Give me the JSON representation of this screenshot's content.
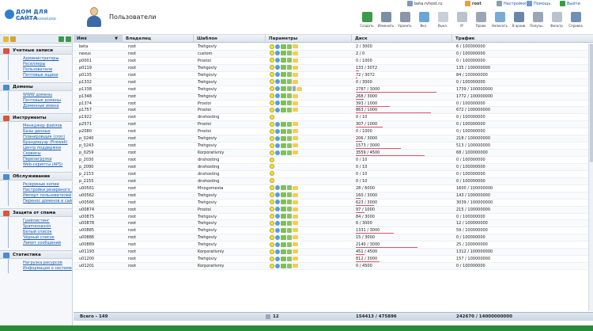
{
  "header": {
    "logo_title": "ДОМ ДЛЯ САЙТА",
    "logo_subtitle": "хостинг-провайдер",
    "page_title": "Пользователи",
    "host": "beta.rvhost.ru",
    "user": "root",
    "links": {
      "settings": "Настройки",
      "help": "Помощь",
      "exit": "Выйти"
    }
  },
  "toolbar": [
    {
      "icon": "create-icon",
      "label": "Создать",
      "color": "#3a9b48"
    },
    {
      "icon": "edit-icon",
      "label": "Изменить",
      "color": "#7a8ea5"
    },
    {
      "icon": "delete-icon",
      "label": "Удалить",
      "color": "#8a96a8"
    },
    {
      "icon": "enable-icon",
      "label": "Вкл.",
      "color": "#6aa4d8"
    },
    {
      "icon": "disable-icon",
      "label": "Выкл.",
      "color": "#c8cfd8"
    },
    {
      "icon": "ip-icon",
      "label": "IP",
      "color": "#b9c3cf"
    },
    {
      "icon": "rights-icon",
      "label": "Права",
      "color": "#9aa6b5"
    },
    {
      "icon": "message-icon",
      "label": "Написать",
      "color": "#7aaad6"
    },
    {
      "icon": "login-icon",
      "label": "В архив",
      "color": "#6a86a8"
    },
    {
      "icon": "columns-icon",
      "label": "Полузы...",
      "color": "#9aa6b5"
    },
    {
      "icon": "filter-icon",
      "label": "Фильтр",
      "color": "#b8c3cf"
    },
    {
      "icon": "help-icon",
      "label": "Справка",
      "color": "#6f8fb5"
    }
  ],
  "sidebar": [
    {
      "title": "Учетные записи",
      "icon_color": "#d9553b",
      "items": [
        "Администраторы",
        "Реселлеры",
        "Пользователи",
        "Почтовые ящики"
      ]
    },
    {
      "title": "Домены",
      "icon_color": "#4a8ad0",
      "items": [
        "WWW домены",
        "Почтовые домены",
        "Доменные имена"
      ]
    },
    {
      "title": "Инструменты",
      "icon_color": "#d9553b",
      "items": [
        "Менеджер файлов",
        "Базы данных",
        "Планировщик (cron)",
        "Брандмауэр (Firewall)",
        "Центр поддержки",
        "Сервисы",
        "Перезагрузка",
        "Web-скрипты (APS)"
      ]
    },
    {
      "title": "Обслуживание",
      "icon_color": "#4a8ad0",
      "items": [
        "Резервные копии",
        "Настройки резервного копирования",
        "Импорт пользователей",
        "Перенос доменов и сайт"
      ]
    },
    {
      "title": "Защита от спама",
      "icon_color": "#d9553b",
      "items": [
        "Грейлистинг",
        "Spamassassin",
        "Белый список",
        "Чёрный список",
        "Лимит сообщений"
      ]
    },
    {
      "title": "Статистика",
      "icon_color": "#4a8ad0",
      "items": [
        "Нагрузка ресурсов",
        "Информация о системе"
      ]
    }
  ],
  "table": {
    "headers": {
      "name": "Имя",
      "owner": "Владелец",
      "template": "Шаблон",
      "params": "Параметры",
      "disk": "Диск",
      "traffic": "Трафик"
    },
    "rows": [
      {
        "name": "beta",
        "owner": "root",
        "template": "Trehgoviy",
        "params": [
          "bulb-on",
          "dot-blue",
          "mail",
          "db",
          "folder"
        ],
        "disk": "2 / 3000",
        "traffic": "6 / 100000000",
        "bar": 0
      },
      {
        "name": "nexus",
        "owner": "root",
        "template": "custom",
        "params": [
          "bulb-on",
          "dot-blue",
          "mail",
          "db",
          "folder"
        ],
        "disk": "2 / 0",
        "traffic": "0 / 100000000",
        "bar": 0
      },
      {
        "name": "p0001",
        "owner": "root",
        "template": "Prostoi",
        "params": [
          "bulb-on",
          "dot-blue",
          "mail",
          "db",
          "folder"
        ],
        "disk": "0 / 1000",
        "traffic": "0 / 100000000",
        "bar": 0
      },
      {
        "name": "p0119",
        "owner": "root",
        "template": "Trehgoviy",
        "params": [
          "bulb-on",
          "dot-blue",
          "mail",
          "db",
          "folder"
        ],
        "disk": "133 / 3072",
        "traffic": "135 / 100000000",
        "bar": 0.04
      },
      {
        "name": "p0135",
        "owner": "root",
        "template": "Trehgoviy",
        "params": [
          "bulb-on",
          "dot-blue",
          "mail",
          "db",
          "folder"
        ],
        "disk": "72 / 3072",
        "traffic": "84 / 100000000",
        "bar": 0.02
      },
      {
        "name": "p1332",
        "owner": "root",
        "template": "Trehgoviy",
        "params": [
          "bulb-on",
          "dot-blue",
          "mail",
          "db",
          "folder"
        ],
        "disk": "0 / 3000",
        "traffic": "0 / 100000000",
        "bar": 0
      },
      {
        "name": "p1338",
        "owner": "root",
        "template": "Trehgoviy",
        "params": [
          "bulb-on",
          "dot-blue",
          "mail",
          "db",
          "doc",
          "folder"
        ],
        "disk": "2787 / 3000",
        "traffic": "1739 / 100000000",
        "bar": 0.93
      },
      {
        "name": "p1348",
        "owner": "root",
        "template": "Trehgoviy",
        "params": [
          "bulb-on",
          "dot-blue",
          "mail",
          "db",
          "folder"
        ],
        "disk": "268 / 3000",
        "traffic": "1772 / 100000000",
        "bar": 0.09
      },
      {
        "name": "p1374",
        "owner": "root",
        "template": "Prostoi",
        "params": [
          "bulb-on",
          "dot-blue",
          "mail",
          "db",
          "folder"
        ],
        "disk": "393 / 1000",
        "traffic": "0 / 100000000",
        "bar": 0.39
      },
      {
        "name": "p1757",
        "owner": "root",
        "template": "Prostoi",
        "params": [
          "bulb-on",
          "dot-blue",
          "mail",
          "db",
          "folder"
        ],
        "disk": "863 / 1000",
        "traffic": "672 / 100000000",
        "bar": 0.86
      },
      {
        "name": "p1922",
        "owner": "root",
        "template": "dnshosting",
        "params": [
          "bulb-on"
        ],
        "disk": "0 / 10",
        "traffic": "0 / 100000000",
        "bar": 0
      },
      {
        "name": "p2571",
        "owner": "root",
        "template": "Prostoi",
        "params": [
          "bulb-on",
          "dot-blue",
          "mail",
          "db",
          "folder"
        ],
        "disk": "307 / 1000",
        "traffic": "0 / 100000000",
        "bar": 0.31
      },
      {
        "name": "p2080",
        "owner": "root",
        "template": "Prostoi",
        "params": [
          "bulb-on",
          "dot-blue",
          "mail",
          "db",
          "folder"
        ],
        "disk": "0 / 1000",
        "traffic": "0 / 100000000",
        "bar": 0
      },
      {
        "name": "p_0240",
        "owner": "root",
        "template": "Trehgoviy",
        "params": [
          "bulb-on",
          "dot-blue",
          "mail",
          "db",
          "folder"
        ],
        "disk": "206 / 3000",
        "traffic": "218 / 100000000",
        "bar": 0.07
      },
      {
        "name": "p_0243",
        "owner": "root",
        "template": "Trehgoviy",
        "params": [
          "bulb-on",
          "dot-blue",
          "mail",
          "db",
          "folder"
        ],
        "disk": "1573 / 3000",
        "traffic": "513 / 100000000",
        "bar": 0.52
      },
      {
        "name": "p_0259",
        "owner": "root",
        "template": "Korporativniy",
        "params": [
          "bulb-on",
          "dot-blue",
          "mail",
          "db",
          "folder"
        ],
        "disk": "3559 / 4500",
        "traffic": "68 / 100000000",
        "bar": 0.79
      },
      {
        "name": "p_2030",
        "owner": "root",
        "template": "dnshosting",
        "params": [
          "bulb-on"
        ],
        "disk": "0 / 10",
        "traffic": "0 / 100000000",
        "bar": 0
      },
      {
        "name": "p_2090",
        "owner": "root",
        "template": "dnshosting",
        "params": [
          "bulb-on"
        ],
        "disk": "0 / 10",
        "traffic": "0 / 100000000",
        "bar": 0
      },
      {
        "name": "p_2153",
        "owner": "root",
        "template": "dnshosting",
        "params": [
          "bulb-on"
        ],
        "disk": "0 / 10",
        "traffic": "0 / 100000000",
        "bar": 0
      },
      {
        "name": "p_2155",
        "owner": "root",
        "template": "dnshosting",
        "params": [
          "bulb-on"
        ],
        "disk": "0 / 10",
        "traffic": "0 / 100000000",
        "bar": 0
      },
      {
        "name": "u00561",
        "owner": "root",
        "template": "Mnogomesta",
        "params": [
          "bulb-on",
          "dot-blue",
          "mail",
          "db",
          "folder"
        ],
        "disk": "28 / 6000",
        "traffic": "1600 / 100000000",
        "bar": 0
      },
      {
        "name": "u00562",
        "owner": "root",
        "template": "Trehgoviy",
        "params": [
          "bulb-on",
          "dot-blue",
          "mail",
          "db",
          "folder"
        ],
        "disk": "160 / 3000",
        "traffic": "143 / 100000000",
        "bar": 0.05
      },
      {
        "name": "u00566",
        "owner": "root",
        "template": "Trehgoviy",
        "params": [
          "bulb-on",
          "dot-blue",
          "mail",
          "db",
          "folder"
        ],
        "disk": "623 / 3000",
        "traffic": "3039 / 100000000",
        "bar": 0.21
      },
      {
        "name": "u00874",
        "owner": "root",
        "template": "Prostoi",
        "params": [
          "bulb-on",
          "dot-blue",
          "mail",
          "db",
          "folder"
        ],
        "disk": "97 / 1000",
        "traffic": "215 / 100000000",
        "bar": 0.1
      },
      {
        "name": "u00875",
        "owner": "root",
        "template": "Trehgoviy",
        "params": [
          "bulb-on",
          "dot-blue",
          "mail",
          "db",
          "folder"
        ],
        "disk": "84 / 3000",
        "traffic": "0 / 100000000",
        "bar": 0
      },
      {
        "name": "u00878",
        "owner": "root",
        "template": "Trehgoviy",
        "params": [
          "bulb-on",
          "dot-blue",
          "mail",
          "db",
          "folder"
        ],
        "disk": "6 / 3000",
        "traffic": "12 / 100000000",
        "bar": 0
      },
      {
        "name": "u00885",
        "owner": "root",
        "template": "Trehgoviy",
        "params": [
          "bulb-on",
          "dot-blue",
          "mail",
          "db",
          "folder"
        ],
        "disk": "1331 / 3000",
        "traffic": "59 / 100000000",
        "bar": 0.44
      },
      {
        "name": "u00886",
        "owner": "root",
        "template": "Trehgoviy",
        "params": [
          "bulb-on",
          "dot-blue",
          "mail",
          "db",
          "folder"
        ],
        "disk": "15 / 3000",
        "traffic": "0 / 100000000",
        "bar": 0
      },
      {
        "name": "u00889",
        "owner": "root",
        "template": "Trehgoviy",
        "params": [
          "bulb-on",
          "dot-blue",
          "mail",
          "db",
          "folder"
        ],
        "disk": "2140 / 3000",
        "traffic": "25 / 100000000",
        "bar": 0.71
      },
      {
        "name": "u01193",
        "owner": "root",
        "template": "Korporativniy",
        "params": [
          "bulb-on",
          "dot-blue",
          "mail",
          "db",
          "folder"
        ],
        "disk": "451 / 4500",
        "traffic": "1312 / 100000000",
        "bar": 0.1
      },
      {
        "name": "u01200",
        "owner": "root",
        "template": "Trehgoviy",
        "params": [
          "bulb-on",
          "dot-blue",
          "mail",
          "db",
          "folder"
        ],
        "disk": "812 / 3000",
        "traffic": "157 / 100000000",
        "bar": 0.27
      },
      {
        "name": "u01201",
        "owner": "root",
        "template": "Korporativniy",
        "params": [
          "bulb-on",
          "dot-blue",
          "mail",
          "db",
          "folder"
        ],
        "disk": "0 / 4500",
        "traffic": "0 / 100000000",
        "bar": 0
      }
    ],
    "footer": {
      "total": "Всего - 149",
      "params_count": "12",
      "disk_total": "154413 / 475896",
      "traffic_total": "242670 / 14000000000"
    }
  }
}
